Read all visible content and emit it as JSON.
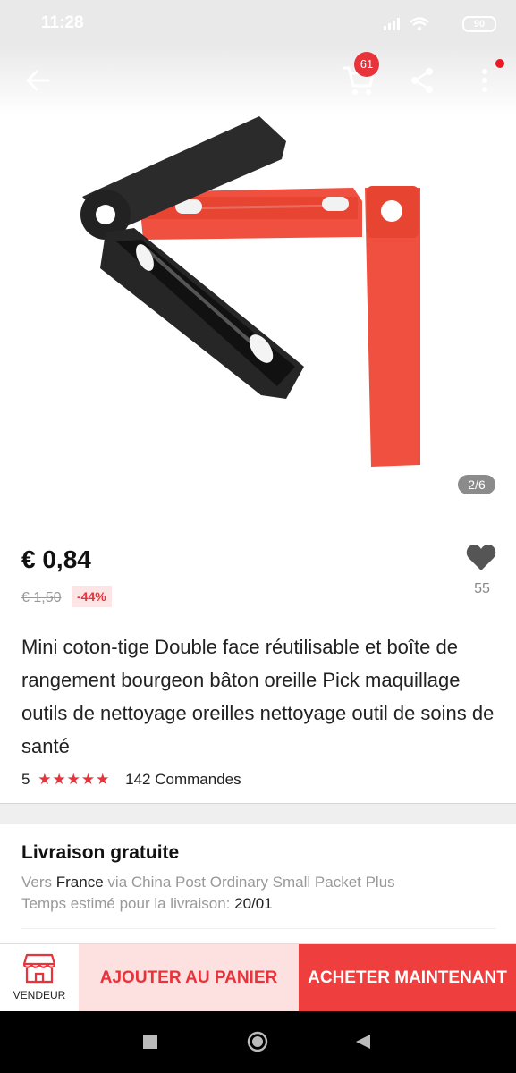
{
  "status_bar": {
    "time": "11:28",
    "battery": "90"
  },
  "header": {
    "cart_count": "61"
  },
  "gallery": {
    "counter": "2/6"
  },
  "product": {
    "price": "€ 0,84",
    "old_price": "€ 1,50",
    "discount": "-44%",
    "favorites": "55",
    "title": "Mini coton-tige Double face réutilisable et boîte de rangement bourgeon bâton oreille Pick maquillage outils de nettoyage oreilles nettoyage outil de soins de santé",
    "rating": "5",
    "stars": "★★★★★",
    "orders": "142 Commandes"
  },
  "shipping": {
    "title": "Livraison gratuite",
    "to_label": "Vers",
    "country": "France",
    "via": "via China Post Ordinary Small Packet Plus",
    "eta_label": "Temps estimé pour la livraison:",
    "eta_date": "20/01"
  },
  "actions": {
    "seller_label": "VENDEUR",
    "add_to_cart": "AJOUTER AU PANIER",
    "buy_now": "ACHETER MAINTENANT"
  },
  "colors": {
    "accent": "#e8333a",
    "buy": "#ef3e3e",
    "add_bg": "#fde0e0"
  },
  "icons": [
    "back-arrow-icon",
    "cart-icon",
    "share-icon",
    "more-icon",
    "heart-icon",
    "store-icon",
    "recents-icon",
    "home-icon",
    "back-triangle-icon"
  ]
}
